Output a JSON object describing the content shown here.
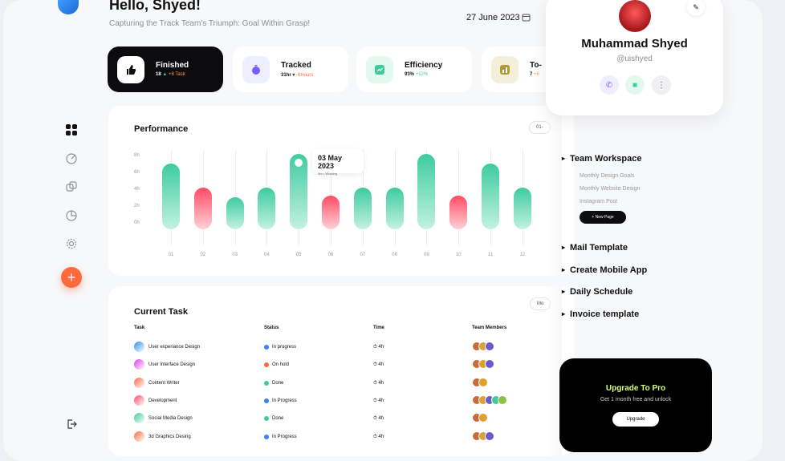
{
  "header": {
    "greeting": "Hello, Shyed!",
    "subtitle": "Capturing the Track Team's Triumph: Goal Within Grasp!",
    "date": "27 June 2023"
  },
  "stats": [
    {
      "title": "Finished",
      "value": "18",
      "delta": "+8 Task",
      "icon": "thumbs-up-icon",
      "dark": true
    },
    {
      "title": "Tracked",
      "value": "31hr",
      "delta": "-6Hours",
      "icon": "timer-icon"
    },
    {
      "title": "Efficiency",
      "value": "93%",
      "delta": "+12%",
      "icon": "trend-icon"
    },
    {
      "title": "To-",
      "value": "7",
      "delta": "+8",
      "icon": "chart-icon"
    }
  ],
  "performance": {
    "title": "Performance",
    "range_pill": "01-",
    "tooltip": {
      "date": "03 May 2023",
      "detail": "3hr • Working"
    }
  },
  "chart_data": {
    "type": "bar",
    "categories": [
      "01",
      "02",
      "03",
      "04",
      "05",
      "06",
      "07",
      "08",
      "09",
      "10",
      "11",
      "12"
    ],
    "values": [
      7.8,
      5.0,
      3.8,
      5.0,
      9.0,
      4.0,
      5.0,
      5.0,
      9.0,
      4.0,
      7.8,
      5.0
    ],
    "status": [
      "good",
      "bad",
      "good",
      "good",
      "good",
      "bad",
      "good",
      "good",
      "good",
      "bad",
      "good",
      "good"
    ],
    "y_ticks": [
      "8h",
      "6h",
      "4h",
      "2h",
      "0h"
    ],
    "colors": {
      "good": "#3fcb9e",
      "bad": "#ff4d63"
    },
    "selected_index": 4
  },
  "tasks": {
    "title": "Current Task",
    "filter": "Mo",
    "columns": [
      "Task",
      "Status",
      "Time",
      "Team Members"
    ],
    "rows": [
      {
        "name": "User experiance Design",
        "status": "In progress",
        "time": "4h",
        "color": "#2d8cf0",
        "status_color": "#3b82f6",
        "members": 3
      },
      {
        "name": "User Interface Design",
        "status": "On hold",
        "time": "4h",
        "color": "#d63ee8",
        "status_color": "#ff6a3d",
        "members": 3
      },
      {
        "name": "Content Writer",
        "status": "Done",
        "time": "4h",
        "color": "#ff6a3d",
        "status_color": "#3fcb9e",
        "members": 2
      },
      {
        "name": "Development",
        "status": "In Progress",
        "time": "4h",
        "color": "#ff4d63",
        "status_color": "#3b82f6",
        "members": 5
      },
      {
        "name": "Social Media Design",
        "status": "Done",
        "time": "4h",
        "color": "#3fcb9e",
        "status_color": "#3fcb9e",
        "members": 2
      },
      {
        "name": "3d Graphics Desing",
        "status": "In Progress",
        "time": "4h",
        "color": "#ff6a3d",
        "status_color": "#3b82f6",
        "members": 3
      }
    ]
  },
  "profile": {
    "name": "Muhammad Shyed",
    "handle": "@uishyed"
  },
  "workspace": {
    "title": "Team Workspace",
    "items": [
      "Monthly Design Goals",
      "Monthly Website Design",
      "Instagram Post"
    ],
    "new_page": "+ New Page"
  },
  "folders": [
    "Mail Template",
    "Create Mobile App",
    "Daily Schedule",
    "Invoice template"
  ],
  "upgrade": {
    "title": "Upgrade To Pro",
    "subtitle": "Get 1 month free and unlock",
    "button": "Upgrade"
  }
}
